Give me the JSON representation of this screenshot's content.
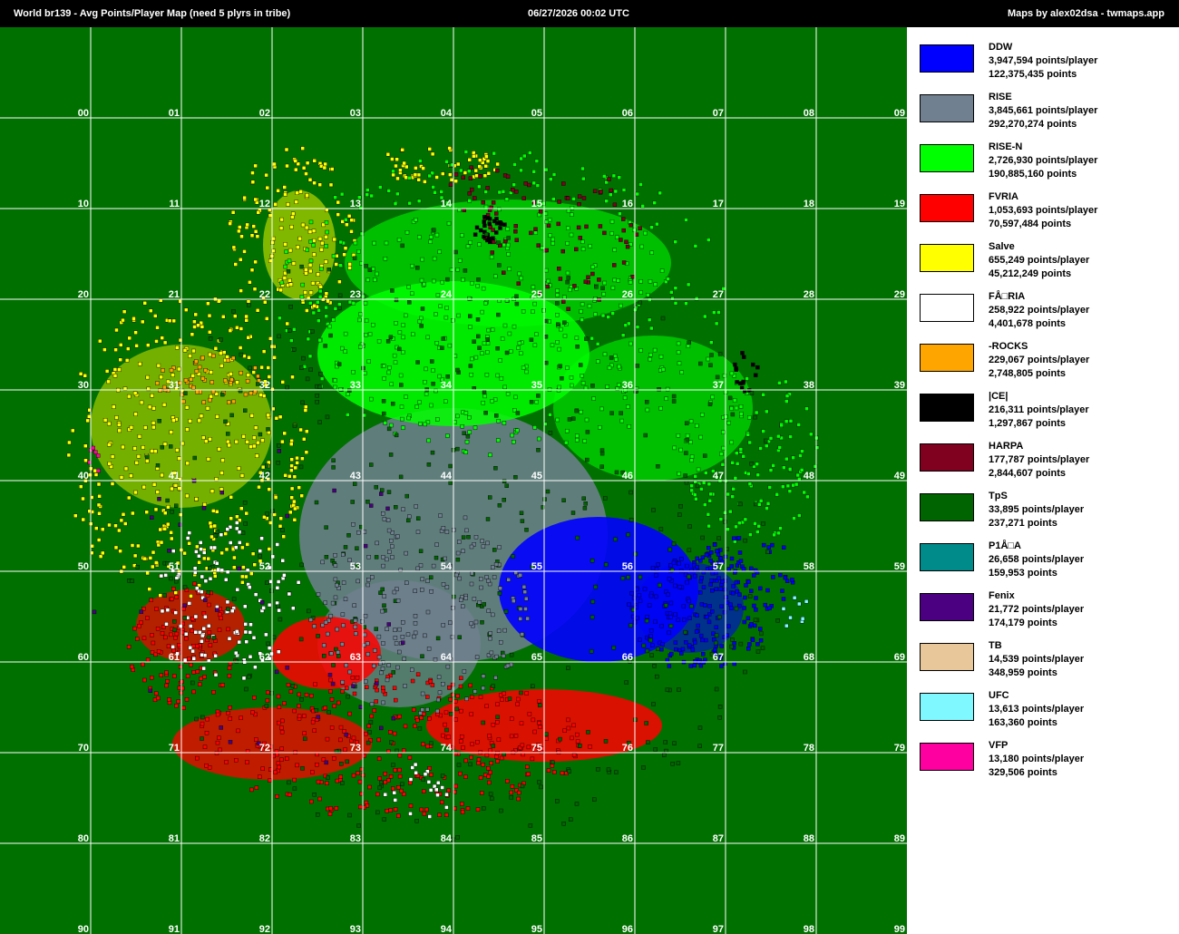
{
  "header": {
    "left": "World br139  -  Avg Points/Player Map (need 5 plyrs in tribe)",
    "center": "06/27/2026 00:02 UTC",
    "right": "Maps by alex02dsa - twmaps.app"
  },
  "map": {
    "background_color": "#007000",
    "grid_color": "#ffffff",
    "continent_labels": [
      "00",
      "01",
      "02",
      "03",
      "04",
      "05",
      "06",
      "07",
      "08",
      "09",
      "10",
      "11",
      "12",
      "13",
      "14",
      "15",
      "16",
      "17",
      "18",
      "19",
      "20",
      "21",
      "22",
      "23",
      "24",
      "25",
      "26",
      "27",
      "28",
      "29",
      "30",
      "31",
      "32",
      "33",
      "34",
      "35",
      "36",
      "37",
      "38",
      "39",
      "40",
      "41",
      "42",
      "43",
      "44",
      "45",
      "46",
      "47",
      "48",
      "49",
      "50",
      "51",
      "52",
      "53",
      "54",
      "55",
      "56",
      "57",
      "58",
      "59",
      "60",
      "61",
      "62",
      "63",
      "64",
      "65",
      "66",
      "67",
      "68",
      "69",
      "70",
      "71",
      "72",
      "73",
      "74",
      "75",
      "76",
      "77",
      "78",
      "79",
      "80",
      "81",
      "82",
      "83",
      "84",
      "85",
      "86",
      "87",
      "88",
      "89",
      "90",
      "91",
      "92",
      "93",
      "94",
      "95",
      "96",
      "97",
      "98",
      "99"
    ]
  },
  "legend": [
    {
      "name": "DDW",
      "avg": "3,947,594 points/player",
      "total": "122,375,435 points",
      "color": "#0000ff"
    },
    {
      "name": "RISE",
      "avg": "3,845,661 points/player",
      "total": "292,270,274 points",
      "color": "#708090"
    },
    {
      "name": "RISE-N",
      "avg": "2,726,930 points/player",
      "total": "190,885,160 points",
      "color": "#00ff00"
    },
    {
      "name": "FVRIA",
      "avg": "1,053,693 points/player",
      "total": "70,597,484 points",
      "color": "#ff0000"
    },
    {
      "name": "Salve",
      "avg": "655,249 points/player",
      "total": "45,212,249 points",
      "color": "#ffff00"
    },
    {
      "name": "FÅ□RIA",
      "avg": "258,922 points/player",
      "total": "4,401,678 points",
      "color": "#ffffff"
    },
    {
      "name": "-ROCKS",
      "avg": "229,067 points/player",
      "total": "2,748,805 points",
      "color": "#ffa500"
    },
    {
      "name": "|CE|",
      "avg": "216,311 points/player",
      "total": "1,297,867 points",
      "color": "#000000"
    },
    {
      "name": "HARPA",
      "avg": "177,787 points/player",
      "total": "2,844,607 points",
      "color": "#800020"
    },
    {
      "name": "TpS",
      "avg": "33,895 points/player",
      "total": "237,271 points",
      "color": "#006400"
    },
    {
      "name": "P1Å□A",
      "avg": "26,658 points/player",
      "total": "159,953 points",
      "color": "#008b8b"
    },
    {
      "name": "Fenix",
      "avg": "21,772 points/player",
      "total": "174,179 points",
      "color": "#4b0082"
    },
    {
      "name": "TB",
      "avg": "14,539 points/player",
      "total": "348,959 points",
      "color": "#e8c89a"
    },
    {
      "name": "UFC",
      "avg": "13,613 points/player",
      "total": "163,360 points",
      "color": "#80f8ff"
    },
    {
      "name": "VFP",
      "avg": "13,180 points/player",
      "total": "329,506 points",
      "color": "#ff00a0"
    }
  ]
}
